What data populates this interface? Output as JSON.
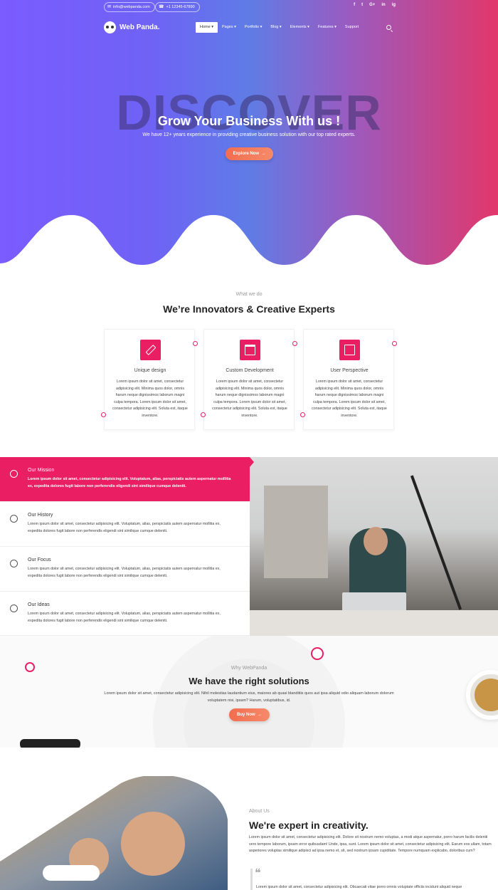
{
  "colors": {
    "accent": "#e91e63",
    "button_gradient": [
      "#f36d4f",
      "#f58a6a"
    ],
    "hero_gradient": [
      "#7b5cff",
      "#5f7ce6",
      "#e2376a"
    ]
  },
  "topbar": {
    "email": "info@webpanda.com",
    "phone": "+1 12345-67890",
    "email_icon": "envelope-icon",
    "phone_icon": "phone-icon",
    "social": [
      "f",
      "t",
      "G+",
      "in",
      "ig"
    ]
  },
  "brand": {
    "name": "Web Panda."
  },
  "nav": [
    "Home",
    "Pages",
    "Portfolio",
    "Blog",
    "Elements",
    "Features",
    "Support"
  ],
  "hero": {
    "bg_word": "DISCOVER",
    "title": "Grow Your Business With us !",
    "subtitle": "We have 12+ years experience in providing creative business solution with our top rated experts.",
    "button": "Explore Now"
  },
  "services": {
    "eyebrow": "What we do",
    "title": "We’re Innovators & Creative Experts",
    "cards": [
      {
        "title": "Unique design",
        "icon": "pencil-icon",
        "text": "Lorem ipsum dolor sit amet, consectetur adipisicing elit. Minima quos dolor, omnis harum neque dignissimos laborum magni culpa tempora. Lorem ipsum dolor sit amet, consectetur adipisicing elit. Soluta est, itaque inventore."
      },
      {
        "title": "Custom Development",
        "icon": "browser-window-icon",
        "text": "Lorem ipsum dolor sit amet, consectetur adipisicing elit. Minima quos dolor, omnis harum neque dignissimos laborum magni culpa tempora. Lorem ipsum dolor sit amet, consectetur adipisicing elit. Soluta est, itaque inventore."
      },
      {
        "title": "User Perspective",
        "icon": "sliders-icon",
        "text": "Lorem ipsum dolor sit amet, consectetur adipisicing elit. Minima quos dolor, omnis harum neque dignissimos laborum magni culpa tempora. Lorem ipsum dolor sit amet, consectetur adipisicing elit. Soluta est, itaque inventore."
      }
    ]
  },
  "features": [
    {
      "title": "Our Mission",
      "icon": "target-icon",
      "text": "Lorem ipsum dolor sit amet, consectetur adipisicing elit. Voluptatum, alias, perspiciatis autem aspernatur mollitia ex, expedita dolores fugit labore non perferendis eligendi sint similique cumque deleniti.",
      "active": true
    },
    {
      "title": "Our History",
      "icon": "lightbulb-icon",
      "text": "Lorem ipsum dolor sit amet, consectetur adipisicing elit. Voluptatum, alias, perspiciatis autem aspernatur mollitia ex, expedita dolores fugit labore non perferendis eligendi sint similique cumque deleniti.",
      "active": false
    },
    {
      "title": "Our Focus",
      "icon": "chess-knight-icon",
      "text": "Lorem ipsum dolor sit amet, consectetur adipisicing elit. Voluptatum, alias, perspiciatis autem aspernatur mollitia ex, expedita dolores fugit labore non perferendis eligendi sint similique cumque deleniti.",
      "active": false
    },
    {
      "title": "Our Ideas",
      "icon": "lightbulb-icon",
      "text": "Lorem ipsum dolor sit amet, consectetur adipisicing elit. Voluptatum, alias, perspiciatis autem aspernatur mollitia ex, expedita dolores fugit labore non perferendis eligendi sint similique cumque deleniti.",
      "active": false
    }
  ],
  "why": {
    "eyebrow": "Why WebPanda",
    "title": "We have the right solutions",
    "text": "Lorem ipsum dolor sit amet, consectetur adipisicing elit. Nihil molestias laudantium eius, maiores ab quasi blanditiis quos aut ipsa aliquid odio aliquam laborum dolorum voluptatem nisi, ipsam? Harum, voluptatibus, id.",
    "button": "Buy Now"
  },
  "about": {
    "eyebrow": "About Us",
    "title": "We're expert in creativity.",
    "text": "Lorem ipsum dolor sit amet, consectetur adipisicing elit. Dolore sit nostrum nemo voluptas, a modi atque aspernatur, porro harum facilis deleniti vero tempore laborum, ipsam error quibusdam! Unde, ipsa, sunt. Lorem ipsum dolor sit amet, consectetur adipisicing elit. Earum eos ullam, totam asperiores voluptas similique adipisci ad ipsa nemo et, sit, sed nostrum ipsam cupiditate. Tempore numquam explicabo, doloribus cum?",
    "quote_mark": "❝",
    "quote": "Lorem ipsum dolor sit amet, consectetur adipisicing elit. Obcaecati vitae porro omnis voluptate officiis incidunt aliquid neque"
  }
}
